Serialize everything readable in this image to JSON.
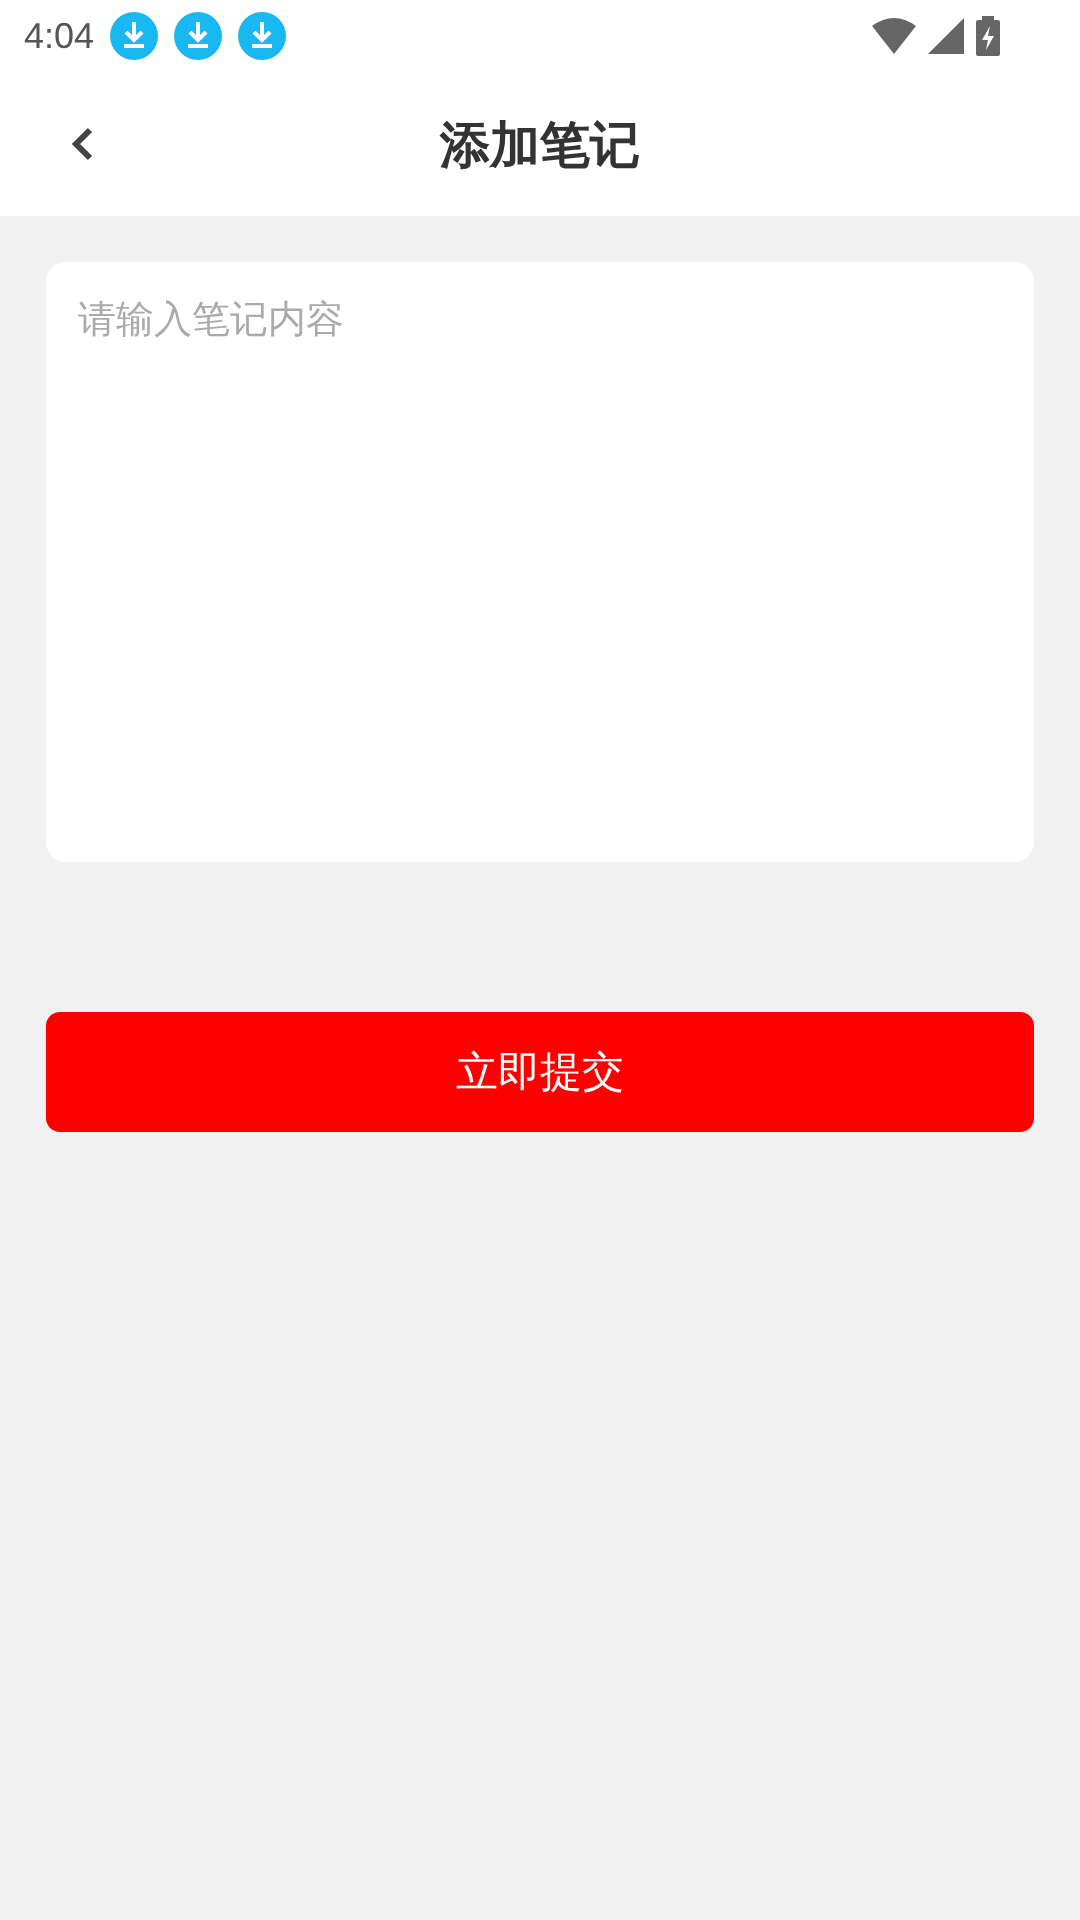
{
  "status_bar": {
    "time": "4:04"
  },
  "header": {
    "title": "添加笔记"
  },
  "note_field": {
    "placeholder": "请输入笔记内容"
  },
  "submit_button": {
    "label": "立即提交"
  }
}
